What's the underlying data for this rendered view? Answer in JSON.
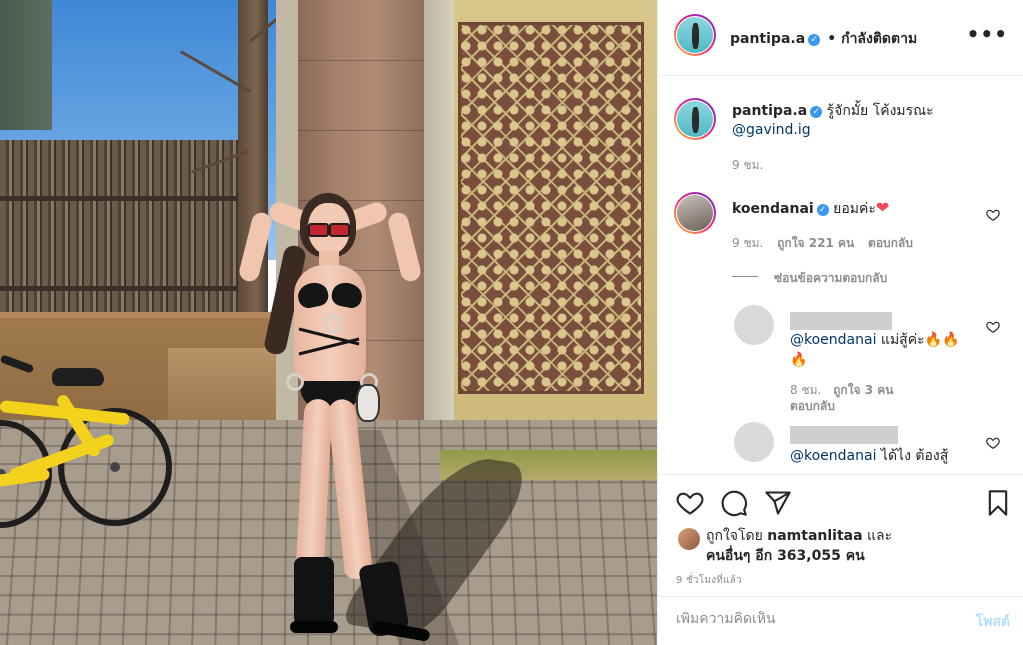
{
  "post": {
    "author": "pantipa.a",
    "verified_mark": "✓",
    "follow_status": "• กำลังติดตาม",
    "more_icon": "more-horizontal-icon"
  },
  "caption": {
    "author": "pantipa.a",
    "text": "รู้จักมั้ย โค้งมรณะ",
    "mention": "@gavind.ig",
    "time": "9 ชม."
  },
  "comments": [
    {
      "author": "koendanai",
      "text": "ยอมค่ะ",
      "emoji": "❤",
      "time": "9 ชม.",
      "likes": "ถูกใจ 221 คน",
      "reply_label": "ตอบกลับ",
      "hide_replies": "ซ่อนข้อความตอบกลับ"
    }
  ],
  "replies": [
    {
      "mention": "@koendanai",
      "text": "แม่สู้ค่ะ",
      "emoji_line1": "🔥🔥",
      "emoji_line2": "🔥",
      "time": "8 ชม.",
      "likes": "ถูกใจ 3 คน",
      "reply_label": "ตอบกลับ"
    },
    {
      "mention": "@koendanai",
      "text": "ได้ไง ต้องสู้"
    }
  ],
  "likes": {
    "prefix": "ถูกใจโดย",
    "user": "namtanlitaa",
    "and": "และ",
    "others": "คนอื่นๆ อีก 363,055 คน"
  },
  "timestamp": "9 ชั่วโมงที่แล้ว",
  "add_comment": {
    "placeholder": "เพิ่มความคิดเห็น",
    "post_label": "โพสต์"
  },
  "colors": {
    "verified": "#3897f0",
    "heart_red": "#ed4956",
    "post_button_disabled": "#b2dffc"
  }
}
